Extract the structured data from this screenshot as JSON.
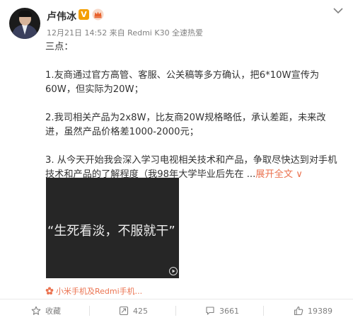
{
  "header": {
    "username": "卢伟冰",
    "verified_badge": "V",
    "meta": "12月21日 14:52 来自 Redmi K30 全速热爱"
  },
  "post": {
    "intro": "三点：",
    "p1": "1.友商通过官方高管、客服、公关稿等多方确认，把6*10W宣传为60W，但实际为20W；",
    "p2": "2.我司相关产品为2x8W，比友商20W规格略低，承认差距，未来改进，虽然产品价格差1000-2000元；",
    "p3": "3. 从今天开始我会深入学习电视相关技术和产品，争取尽快达到对手机技术和产品的了解程度（我98年大学毕业后先在 ...",
    "expand_label": "展开全文",
    "expand_icon": "∨"
  },
  "media": {
    "caption": "“生死看淡，不服就干”"
  },
  "topic": {
    "label": "小米手机及Redmi手机..."
  },
  "actions": {
    "favorite_label": "收藏",
    "repost_count": "425",
    "comment_count": "3661",
    "like_count": "19389"
  },
  "colors": {
    "accent": "#eb7350",
    "verified": "#f49f00",
    "muted_text": "#808080"
  }
}
